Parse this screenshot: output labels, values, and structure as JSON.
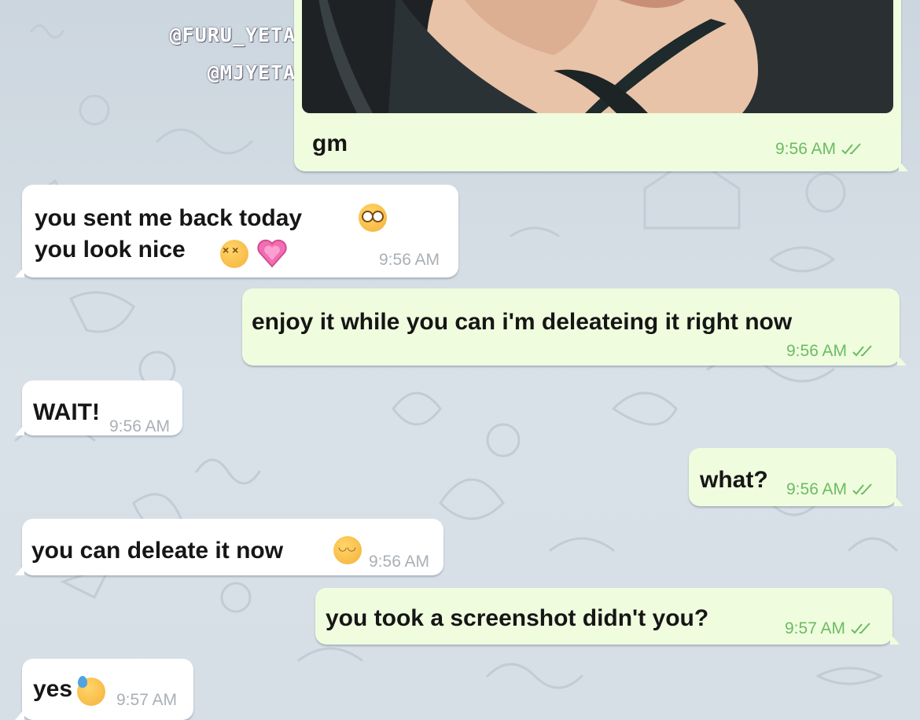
{
  "watermark": {
    "line1": "@FURU_YETA_MJ",
    "line2": "@MJYETA"
  },
  "colors": {
    "incoming_bubble": "#ffffff",
    "outgoing_bubble": "#effdde",
    "outgoing_time": "#6dbb62",
    "incoming_time": "#a9b0b6",
    "wallpaper": "#d3dce4"
  },
  "messages": [
    {
      "direction": "outgoing",
      "has_photo": true,
      "text": "gm",
      "time": "9:56 AM",
      "status_icon": "double-check-icon"
    },
    {
      "direction": "incoming",
      "lines": [
        "you sent me back today",
        "you look nice"
      ],
      "emojis": [
        "flushed-face-emoji",
        "confounded-face-emoji",
        "growing-heart-emoji"
      ],
      "time": "9:56 AM"
    },
    {
      "direction": "outgoing",
      "text": "enjoy it while you can i'm deleateing it right now",
      "time": "9:56 AM",
      "status_icon": "double-check-icon"
    },
    {
      "direction": "incoming",
      "text": "WAIT!",
      "time": "9:56 AM"
    },
    {
      "direction": "outgoing",
      "text": "what?",
      "time": "9:56 AM",
      "status_icon": "double-check-icon"
    },
    {
      "direction": "incoming",
      "text": "you can deleate it now",
      "emojis": [
        "smiling-face-emoji"
      ],
      "time": "9:56 AM"
    },
    {
      "direction": "outgoing",
      "text": "you took a screenshot didn't you?",
      "time": "9:57 AM",
      "status_icon": "double-check-icon"
    },
    {
      "direction": "incoming",
      "text": "yes",
      "emojis": [
        "downcast-sweat-face-emoji"
      ],
      "time": "9:57 AM"
    }
  ]
}
